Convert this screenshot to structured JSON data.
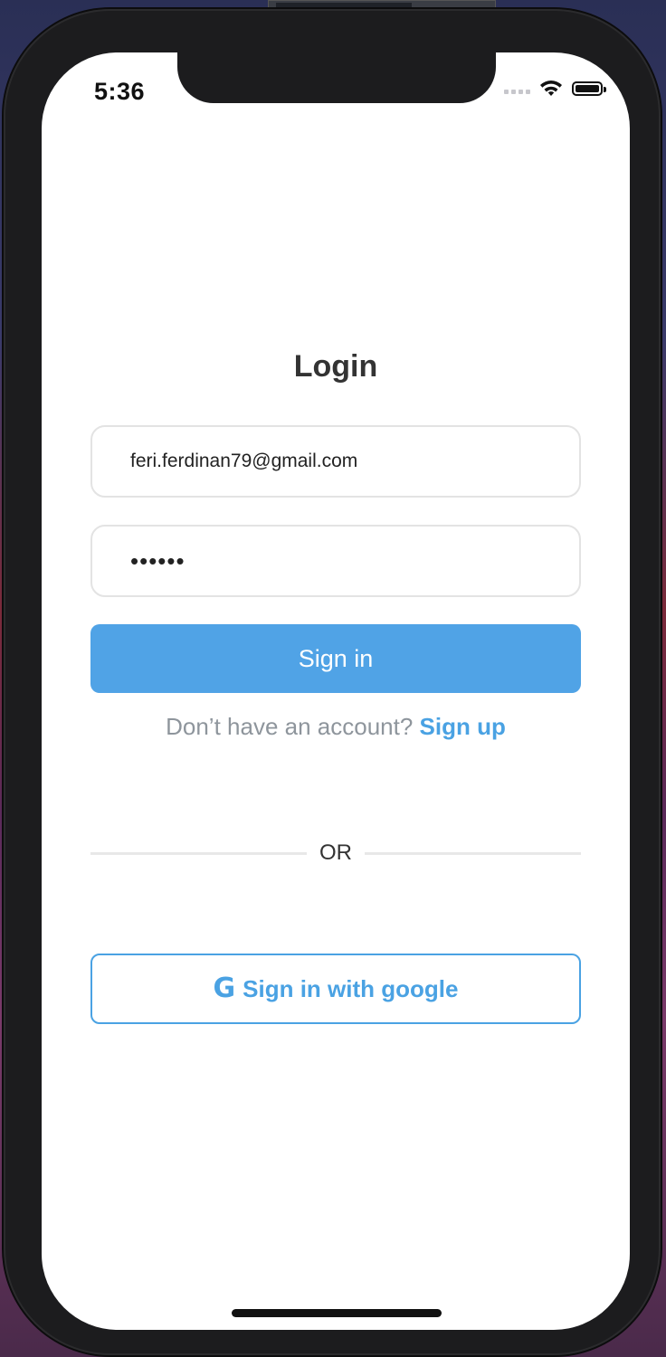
{
  "status_bar": {
    "time": "5:36"
  },
  "login": {
    "title": "Login",
    "email_value": "feri.ferdinan79@gmail.com",
    "password_value": "••••••",
    "signin_label": "Sign in",
    "signup_prompt": "Don’t have an account?",
    "signup_link": "Sign up",
    "divider_text": "OR",
    "google_icon": "G",
    "google_label": "Sign in with google"
  },
  "colors": {
    "accent": "#50a3e6",
    "link": "#4aa2e3",
    "muted_text": "#8e959c"
  },
  "icons": [
    "wifi-icon",
    "battery-icon",
    "cellular-signal-icon",
    "google-icon"
  ]
}
